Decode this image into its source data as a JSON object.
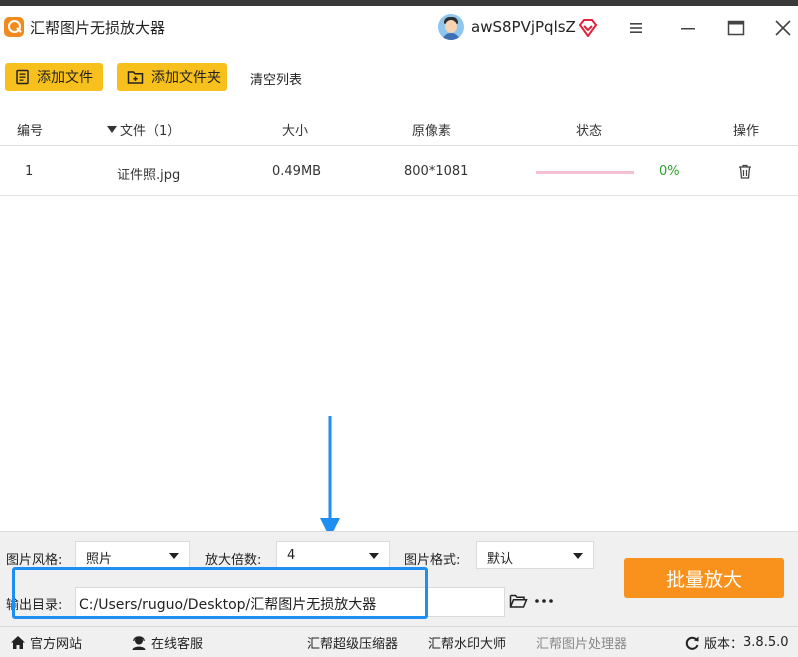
{
  "app": {
    "title": "汇帮图片无损放大器"
  },
  "user": {
    "name": "awS8PVjPqlsZ"
  },
  "toolbar": {
    "add_file": "添加文件",
    "add_folder": "添加文件夹",
    "clear_list": "清空列表"
  },
  "table": {
    "headers": {
      "index": "编号",
      "file": "文件（1）",
      "size": "大小",
      "pixels": "原像素",
      "status": "状态",
      "action": "操作"
    },
    "rows": [
      {
        "index": "1",
        "name": "证件照.jpg",
        "size": "0.49MB",
        "pixels": "800*1081",
        "progress": 0,
        "progress_text": "0%"
      }
    ]
  },
  "settings": {
    "style_label": "图片风格:",
    "style_value": "照片",
    "scale_label": "放大倍数:",
    "scale_value": "4",
    "format_label": "图片格式:",
    "format_value": "默认",
    "output_label": "输出目录:",
    "output_value": "C:/Users/ruguo/Desktop/汇帮图片无损放大器",
    "start_button": "批量放大"
  },
  "footer": {
    "website": "官方网站",
    "support": "在线客服",
    "compressor": "汇帮超级压缩器",
    "watermark": "汇帮水印大师",
    "processor": "汇帮图片处理器",
    "version_label": "版本：",
    "version_value": "3.8.5.0"
  },
  "colors": {
    "accent_yellow": "#f8c01c",
    "accent_orange": "#f8921c",
    "highlight_blue": "#1e8ef0",
    "progress_green": "#2aa52a"
  }
}
